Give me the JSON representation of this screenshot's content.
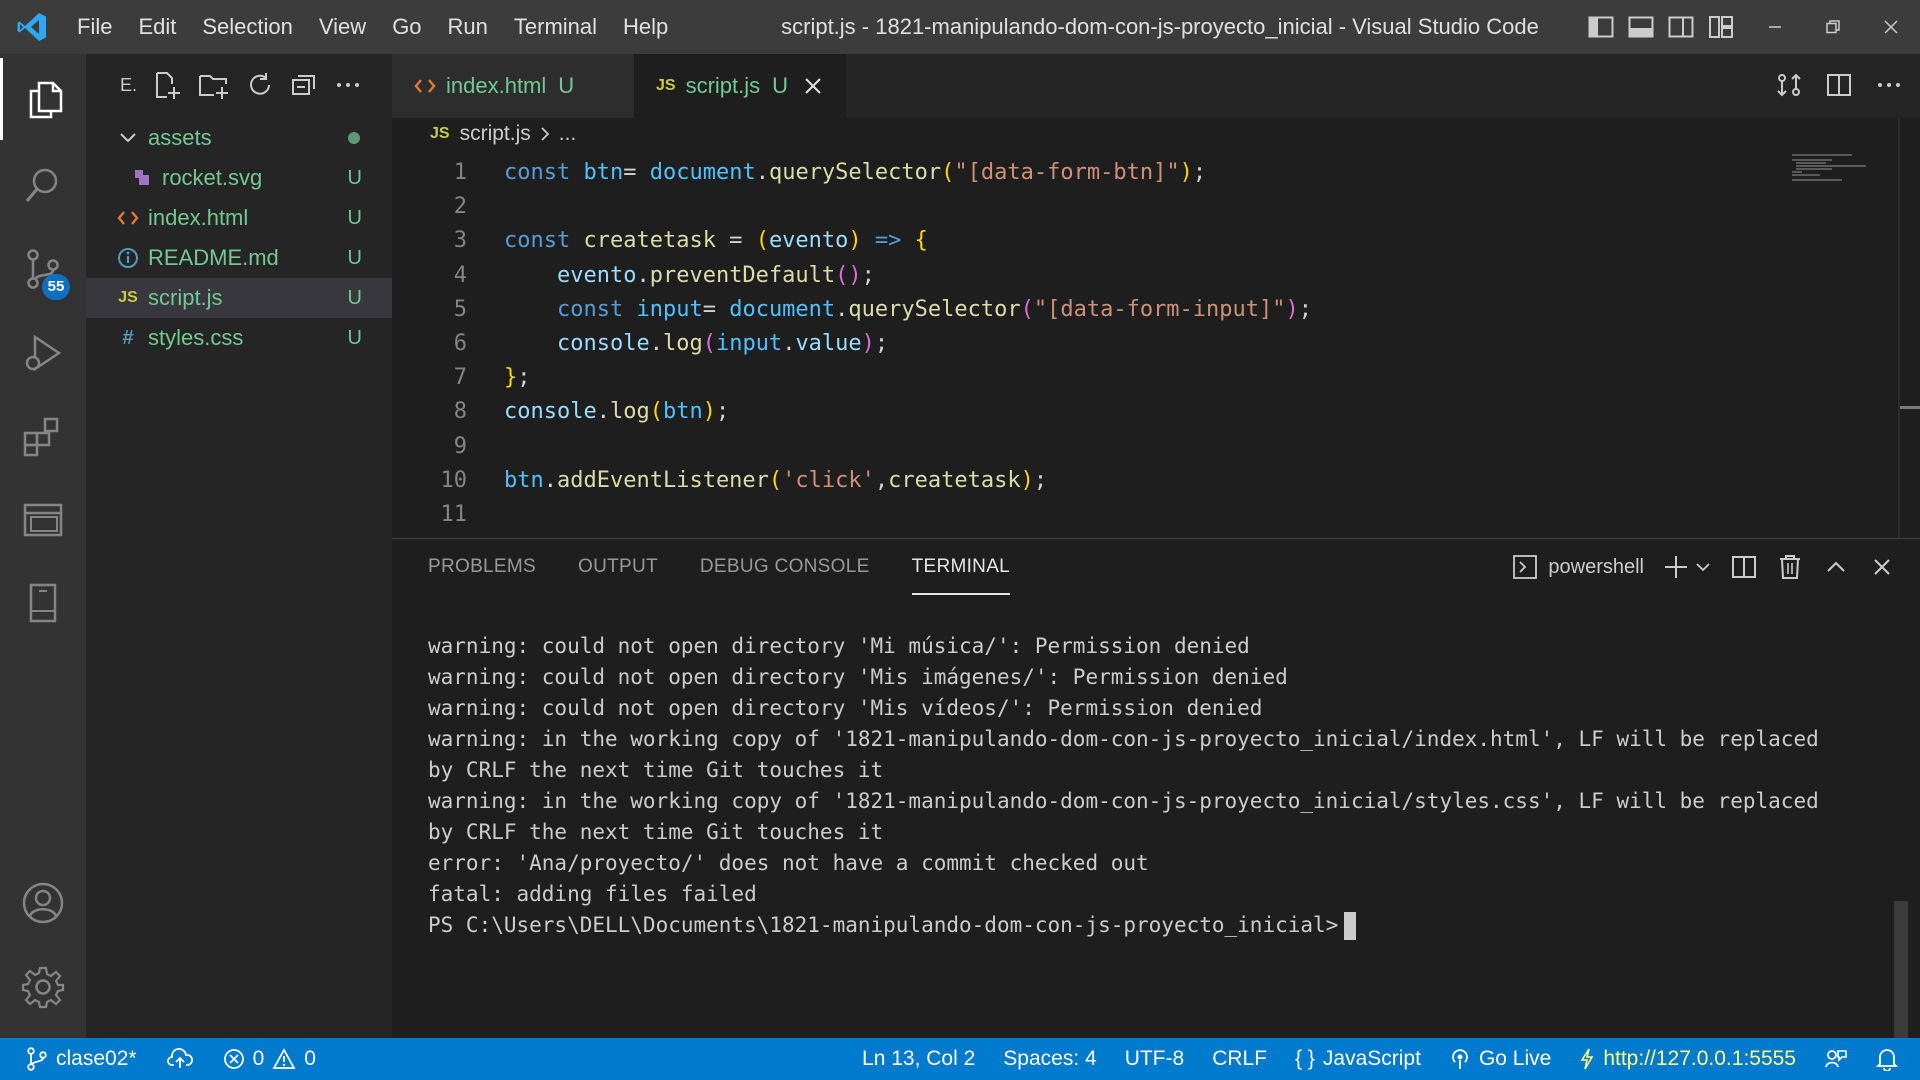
{
  "titlebar": {
    "menu": [
      "File",
      "Edit",
      "Selection",
      "View",
      "Go",
      "Run",
      "Terminal",
      "Help"
    ],
    "window_title": "script.js - 1821-manipulando-dom-con-js-proyecto_inicial - Visual Studio Code"
  },
  "activitybar": {
    "scm_badge": "55"
  },
  "sidebar": {
    "title": "E.",
    "tree": [
      {
        "name": "assets",
        "type": "folder",
        "status": ""
      },
      {
        "name": "rocket.svg",
        "type": "svg",
        "status": "U"
      },
      {
        "name": "index.html",
        "type": "html",
        "status": "U"
      },
      {
        "name": "README.md",
        "type": "info",
        "status": "U"
      },
      {
        "name": "script.js",
        "type": "js",
        "status": "U"
      },
      {
        "name": "styles.css",
        "type": "css",
        "status": "U"
      }
    ]
  },
  "editor": {
    "tabs": [
      {
        "label": "index.html",
        "status": "U",
        "icon": "<>"
      },
      {
        "label": "script.js",
        "status": "U",
        "icon": "JS"
      }
    ],
    "breadcrumb": {
      "icon": "JS",
      "file": "script.js",
      "rest": "..."
    },
    "line_numbers": [
      "1",
      "2",
      "3",
      "4",
      "5",
      "6",
      "7",
      "8",
      "9",
      "10",
      "11"
    ]
  },
  "panel": {
    "tabs": [
      "PROBLEMS",
      "OUTPUT",
      "DEBUG CONSOLE",
      "TERMINAL"
    ],
    "shell_name": "powershell",
    "terminal_lines": [
      "warning: could not open directory 'Mi música/': Permission denied",
      "warning: could not open directory 'Mis imágenes/': Permission denied",
      "warning: could not open directory 'Mis vídeos/': Permission denied",
      "warning: in the working copy of '1821-manipulando-dom-con-js-proyecto_inicial/index.html', LF will be replaced",
      "by CRLF the next time Git touches it",
      "warning: in the working copy of '1821-manipulando-dom-con-js-proyecto_inicial/styles.css', LF will be replaced",
      "by CRLF the next time Git touches it",
      "error: 'Ana/proyecto/' does not have a commit checked out",
      "fatal: adding files failed"
    ],
    "prompt": "PS C:\\Users\\DELL\\Documents\\1821-manipulando-dom-con-js-proyecto_inicial>"
  },
  "statusbar": {
    "branch": "clase02*",
    "errors": "0",
    "warnings": "0",
    "position": "Ln 13, Col 2",
    "spaces": "Spaces: 4",
    "encoding": "UTF-8",
    "eol": "CRLF",
    "language": "JavaScript",
    "golive": "Go Live",
    "server_url": "http://127.0.0.1:5555"
  },
  "colors": {
    "accent": "#007acc",
    "untracked": "#73c991",
    "titlebar": "#3c3c3c",
    "sidebar": "#252526",
    "editor": "#1e1e1e"
  }
}
